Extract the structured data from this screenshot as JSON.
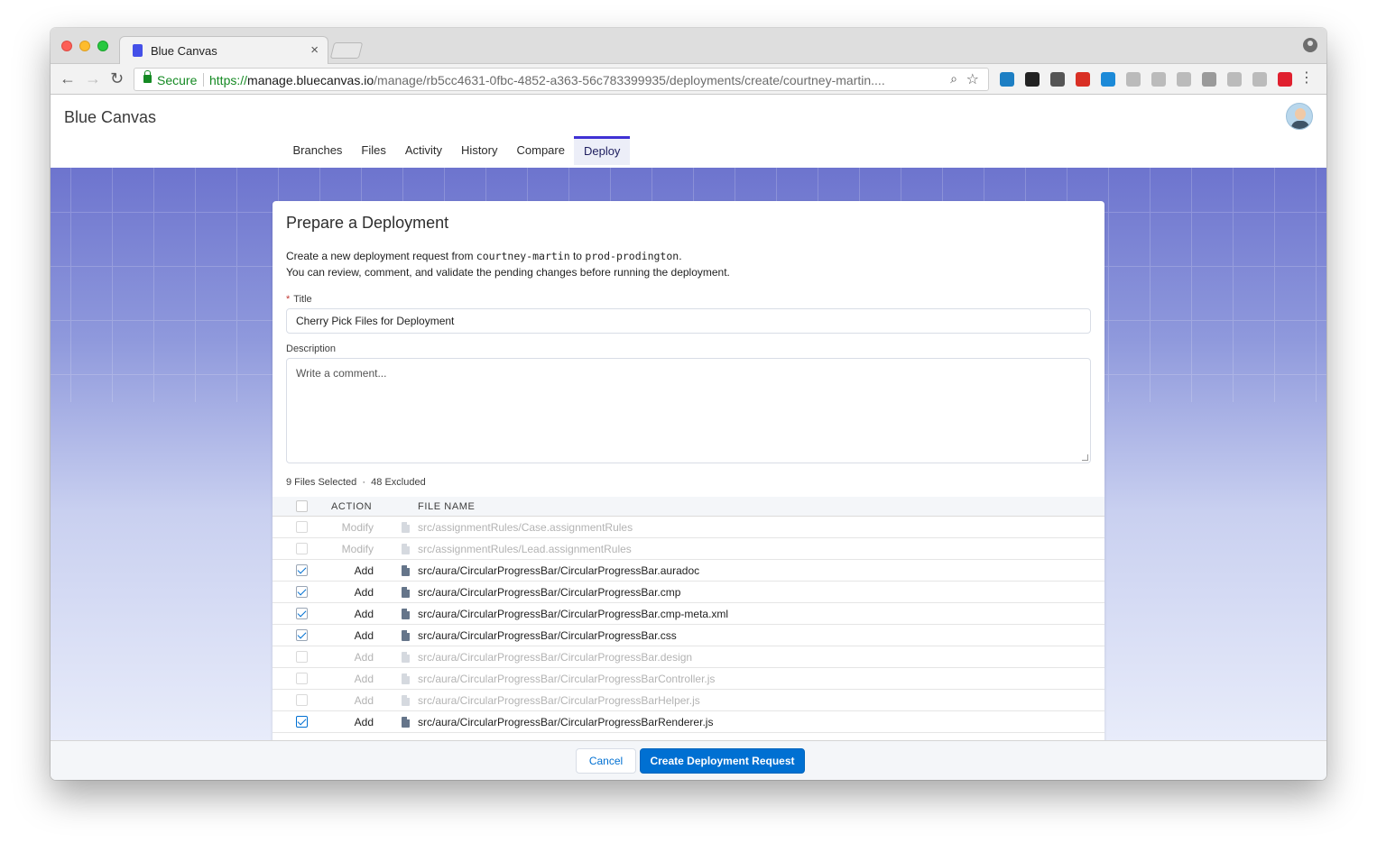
{
  "browser": {
    "tab_title": "Blue Canvas",
    "tab_close": "×",
    "secure_label": "Secure",
    "url_scheme": "https://",
    "url_host": "manage.bluecanvas.io",
    "url_path": "/manage/rb5cc4631-0fbc-4852-a363-56c783399935/deployments/create/courtney-martin....",
    "nav_back": "←",
    "nav_forward": "→",
    "nav_reload": "↻",
    "zoom_icon": "⌕",
    "star_icon": "☆",
    "menu_icon": "⋮",
    "extensions": [
      {
        "name": "trello-icon",
        "color": "#1d7fc4"
      },
      {
        "name": "instapaper-icon",
        "color": "#222222"
      },
      {
        "name": "mail-check-icon",
        "color": "#555555"
      },
      {
        "name": "calendar-icon",
        "color": "#d93025"
      },
      {
        "name": "compass-icon",
        "color": "#1c8ad8"
      },
      {
        "name": "mail-icon",
        "color": "#bbbbbb"
      },
      {
        "name": "grammarly-icon",
        "color": "#bbbbbb"
      },
      {
        "name": "bulb-icon",
        "color": "#bbbbbb"
      },
      {
        "name": "pocket-icon",
        "color": "#9a9a9a"
      },
      {
        "name": "stamp-icon",
        "color": "#bbbbbb"
      },
      {
        "name": "shield-icon",
        "color": "#bbbbbb"
      },
      {
        "name": "opera-icon",
        "color": "#e0202f"
      }
    ]
  },
  "app": {
    "brand": "Blue Canvas",
    "tabs": [
      {
        "label": "Branches",
        "active": false
      },
      {
        "label": "Files",
        "active": false
      },
      {
        "label": "Activity",
        "active": false
      },
      {
        "label": "History",
        "active": false
      },
      {
        "label": "Compare",
        "active": false
      },
      {
        "label": "Deploy",
        "active": true
      }
    ]
  },
  "form": {
    "heading": "Prepare a Deployment",
    "intro_prefix": "Create a new deployment request from ",
    "source_branch": "courtney-martin",
    "intro_mid": " to ",
    "target_branch": "prod-prodington",
    "intro_suffix": ".",
    "intro_line2": "You can review, comment, and validate the pending changes before running the deployment.",
    "required_mark": "*",
    "title_label": "Title",
    "title_value": "Cherry Pick Files for Deployment",
    "description_label": "Description",
    "description_placeholder": "Write a comment...",
    "summary": "9 Files Selected  ·  48 Excluded"
  },
  "table": {
    "col_action": "ACTION",
    "col_filename": "FILE NAME",
    "rows": [
      {
        "checked": false,
        "action": "Modify",
        "file": "src/assignmentRules/Case.assignmentRules"
      },
      {
        "checked": false,
        "action": "Modify",
        "file": "src/assignmentRules/Lead.assignmentRules"
      },
      {
        "checked": true,
        "action": "Add",
        "file": "src/aura/CircularProgressBar/CircularProgressBar.auradoc"
      },
      {
        "checked": true,
        "action": "Add",
        "file": "src/aura/CircularProgressBar/CircularProgressBar.cmp"
      },
      {
        "checked": true,
        "action": "Add",
        "file": "src/aura/CircularProgressBar/CircularProgressBar.cmp-meta.xml"
      },
      {
        "checked": true,
        "action": "Add",
        "file": "src/aura/CircularProgressBar/CircularProgressBar.css"
      },
      {
        "checked": false,
        "action": "Add",
        "file": "src/aura/CircularProgressBar/CircularProgressBar.design"
      },
      {
        "checked": false,
        "action": "Add",
        "file": "src/aura/CircularProgressBar/CircularProgressBarController.js"
      },
      {
        "checked": false,
        "action": "Add",
        "file": "src/aura/CircularProgressBar/CircularProgressBarHelper.js"
      },
      {
        "checked": true,
        "action": "Add",
        "file": "src/aura/CircularProgressBar/CircularProgressBarRenderer.js"
      }
    ]
  },
  "footer": {
    "cancel_label": "Cancel",
    "create_label": "Create Deployment Request"
  }
}
